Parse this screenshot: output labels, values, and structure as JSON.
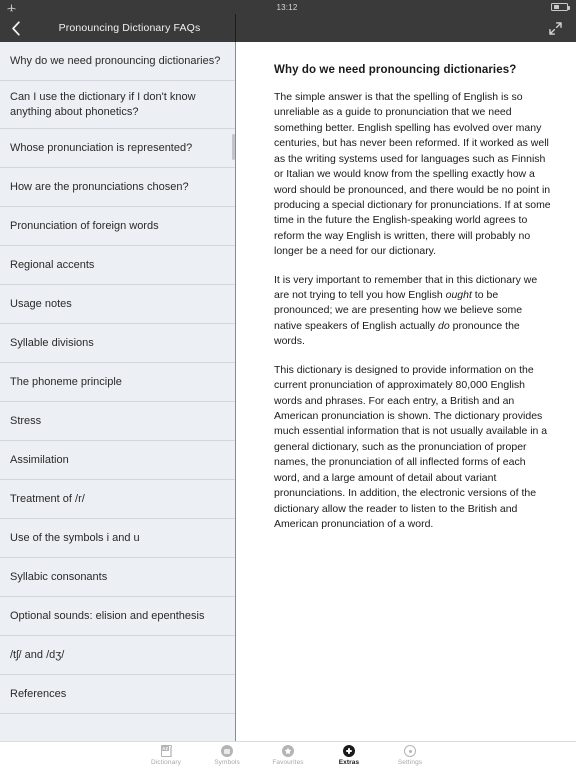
{
  "statusbar": {
    "airplane_icon": "airplane-icon",
    "time": "13:12",
    "battery_icon": "battery-icon",
    "battery_level_percent": 42
  },
  "navbar": {
    "back_icon": "chevron-left-icon",
    "title": "Pronouncing Dictionary FAQs",
    "expand_icon": "expand-diagonal-icon",
    "background_color": "#3a3a3a"
  },
  "sidebar": {
    "background_color": "#eceff3",
    "items": [
      {
        "label": "Why do we need pronouncing dictionaries?",
        "two_line": false
      },
      {
        "label": "Can I use the dictionary if I don't know anything about phonetics?",
        "two_line": true
      },
      {
        "label": "Whose pronunciation is represented?",
        "two_line": false
      },
      {
        "label": "How are the pronunciations chosen?",
        "two_line": false
      },
      {
        "label": "Pronunciation of foreign words",
        "two_line": false
      },
      {
        "label": "Regional accents",
        "two_line": false
      },
      {
        "label": "Usage notes",
        "two_line": false
      },
      {
        "label": "Syllable divisions",
        "two_line": false
      },
      {
        "label": "The phoneme principle",
        "two_line": false
      },
      {
        "label": "Stress",
        "two_line": false
      },
      {
        "label": "Assimilation",
        "two_line": false
      },
      {
        "label": "Treatment of /r/",
        "two_line": false
      },
      {
        "label": "Use of the symbols i and u",
        "two_line": false
      },
      {
        "label": "Syllabic consonants",
        "two_line": false
      },
      {
        "label": "Optional sounds: elision and epenthesis",
        "two_line": false
      },
      {
        "label": "/tʃ/ and /dʒ/",
        "two_line": false
      },
      {
        "label": "References",
        "two_line": false
      }
    ]
  },
  "article": {
    "heading": "Why do we need pronouncing dictionaries?",
    "paragraphs": [
      {
        "parts": [
          {
            "text": "The simple answer is that the spelling of English is so unreliable as a guide to pronunciation that we need something better. English spelling has evolved over many centuries, but has never been reformed. If it worked as well as the writing systems used for languages such as Finnish or Italian we would know from the spelling exactly how a word should be pronounced, and there would be no point in producing a special dictionary for pronunciations. If at some time in the future the English-speaking world agrees to reform the way English is written, there will probably no longer be a need for our dictionary.",
            "italic": false
          }
        ]
      },
      {
        "parts": [
          {
            "text": "It is very important to remember that in this dictionary we are not trying to tell you how English ",
            "italic": false
          },
          {
            "text": "ought",
            "italic": true
          },
          {
            "text": " to be pronounced; we are presenting how we believe some native speakers of English actually ",
            "italic": false
          },
          {
            "text": "do",
            "italic": true
          },
          {
            "text": " pronounce the words.",
            "italic": false
          }
        ]
      },
      {
        "parts": [
          {
            "text": "This dictionary is designed to provide information on the current pronunciation of approximately 80,000 English words and phrases. For each entry, a British and an American pronunciation is shown. The dictionary provides much essential information that is not usually available in a general dictionary, such as the pronunciation of proper names, the pronunciation of all inflected forms of each word, and a large amount of detail about variant pronunciations. In addition, the electronic versions of the dictionary allow the reader to listen to the British and American pronunciation of a word.",
            "italic": false
          }
        ]
      }
    ]
  },
  "tabbar": {
    "tabs": [
      {
        "label": "Dictionary",
        "icon": "book-az-icon",
        "active": false
      },
      {
        "label": "Symbols",
        "icon": "symbols-circle-icon",
        "active": false
      },
      {
        "label": "Favourites",
        "icon": "star-circle-icon",
        "active": false
      },
      {
        "label": "Extras",
        "icon": "plus-circle-icon",
        "active": true
      },
      {
        "label": "Settings",
        "icon": "gear-circle-icon",
        "active": false
      }
    ]
  }
}
